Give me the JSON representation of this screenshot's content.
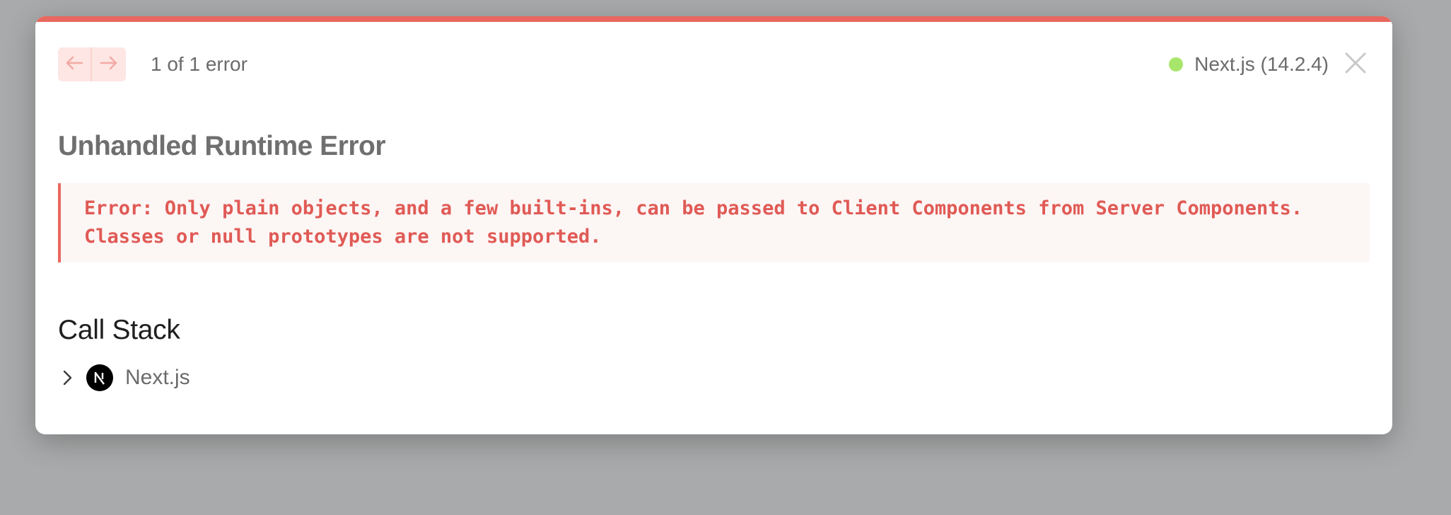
{
  "header": {
    "nav_prev_icon": "arrow-left-icon",
    "nav_next_icon": "arrow-right-icon",
    "error_count": "1 of 1 error",
    "version_label": "Next.js (14.2.4)",
    "close_icon": "close-icon"
  },
  "error": {
    "title": "Unhandled Runtime Error",
    "message_lines": [
      "Error: Only plain objects, and a few built-ins, can be passed to Client Components from Server Components.",
      "Classes or null prototypes are not supported."
    ]
  },
  "call_stack": {
    "title": "Call Stack",
    "items": [
      {
        "label": "Next.js",
        "icon": "nextjs-logo-icon",
        "expand_icon": "chevron-right-icon"
      }
    ]
  },
  "colors": {
    "accent": "#e8685f",
    "error_text": "#e05a55",
    "error_bg": "#fcf6f5",
    "status_dot": "#a8e66b",
    "backdrop": "#a8aaab"
  }
}
